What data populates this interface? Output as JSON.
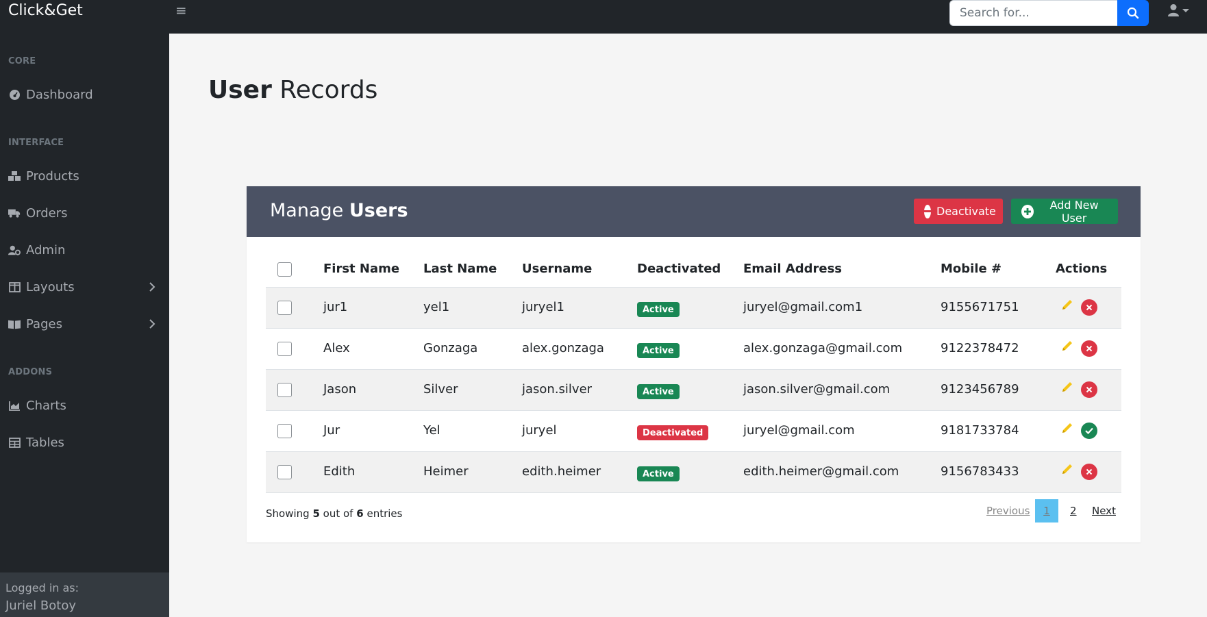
{
  "brand": "Click&Get",
  "search": {
    "placeholder": "Search for..."
  },
  "sidebar": {
    "headings": [
      "CORE",
      "INTERFACE",
      "ADDONS"
    ],
    "items": [
      {
        "label": "Dashboard",
        "icon": "dashboard-icon"
      },
      {
        "label": "Products",
        "icon": "boxes-icon"
      },
      {
        "label": "Orders",
        "icon": "truck-icon"
      },
      {
        "label": "Admin",
        "icon": "user-cog-icon"
      },
      {
        "label": "Layouts",
        "icon": "columns-icon",
        "has_chevron": true
      },
      {
        "label": "Pages",
        "icon": "book-icon",
        "has_chevron": true
      },
      {
        "label": "Charts",
        "icon": "area-chart-icon"
      },
      {
        "label": "Tables",
        "icon": "table-icon"
      }
    ],
    "footer": {
      "label": "Logged in as:",
      "user": "Juriel Botoy"
    }
  },
  "page": {
    "title_bold": "User",
    "title_rest": "Records"
  },
  "card": {
    "title_light": "Manage",
    "title_bold": "Users",
    "deactivate_label": "Deactivate",
    "add_label": "Add New User"
  },
  "table": {
    "headers": [
      "First Name",
      "Last Name",
      "Username",
      "Deactivated",
      "Email Address",
      "Mobile #",
      "Actions"
    ],
    "rows": [
      {
        "first": "jur1",
        "last": "yel1",
        "username": "juryel1",
        "status": "Active",
        "email": "juryel@gmail.com1",
        "mobile": "9155671751"
      },
      {
        "first": "Alex",
        "last": "Gonzaga",
        "username": "alex.gonzaga",
        "status": "Active",
        "email": "alex.gonzaga@gmail.com",
        "mobile": "9122378472"
      },
      {
        "first": "Jason",
        "last": "Silver",
        "username": "jason.silver",
        "status": "Active",
        "email": "jason.silver@gmail.com",
        "mobile": "9123456789"
      },
      {
        "first": "Jur",
        "last": "Yel",
        "username": "juryel",
        "status": "Deactivated",
        "email": "juryel@gmail.com",
        "mobile": "9181733784"
      },
      {
        "first": "Edith",
        "last": "Heimer",
        "username": "edith.heimer",
        "status": "Active",
        "email": "edith.heimer@gmail.com",
        "mobile": "9156783433"
      }
    ]
  },
  "footer": {
    "showing_prefix": "Showing",
    "showing_count": "5",
    "showing_mid": "out of",
    "showing_total": "6",
    "showing_suffix": "entries"
  },
  "pagination": {
    "previous": "Previous",
    "page1": "1",
    "page2": "2",
    "next": "Next"
  },
  "colors": {
    "accent": "#0d6efd",
    "success": "#198754",
    "danger": "#dc3545",
    "header": "#4b5264",
    "sidebar": "#212529"
  }
}
